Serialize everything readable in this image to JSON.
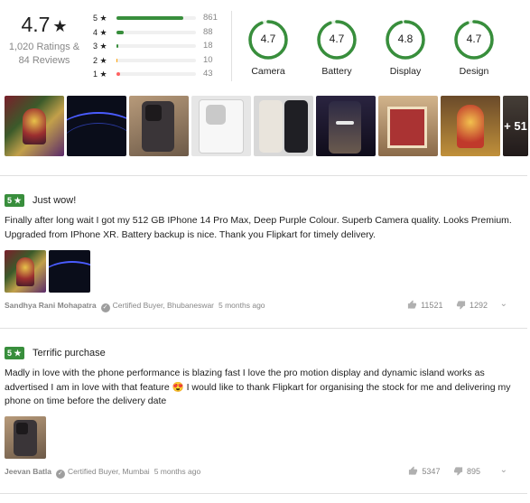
{
  "summary": {
    "overall_rating": "4.7",
    "star_glyph": "★",
    "ratings_text": "1,020 Ratings &",
    "reviews_text": "84 Reviews",
    "breakdown": [
      {
        "label": "5 ★",
        "count": "861",
        "fraction": 0.844,
        "color": "#388e3c"
      },
      {
        "label": "4 ★",
        "count": "88",
        "fraction": 0.086,
        "color": "#388e3c"
      },
      {
        "label": "3 ★",
        "count": "18",
        "fraction": 0.018,
        "color": "#388e3c"
      },
      {
        "label": "2 ★",
        "count": "10",
        "fraction": 0.01,
        "color": "#ff9f00"
      },
      {
        "label": "1 ★",
        "count": "43",
        "fraction": 0.042,
        "color": "#ff6161"
      }
    ],
    "aspects": [
      {
        "name": "Camera",
        "value": "4.7",
        "fraction": 0.94
      },
      {
        "name": "Battery",
        "value": "4.7",
        "fraction": 0.94
      },
      {
        "name": "Display",
        "value": "4.8",
        "fraction": 0.96
      },
      {
        "name": "Design",
        "value": "4.7",
        "fraction": 0.94
      }
    ]
  },
  "photo_strip": {
    "more_label": "+ 51",
    "photos": [
      "deity-idol-photo",
      "phone-wallpaper-dark-photo",
      "phone-camera-back-photo",
      "phone-in-box-photo",
      "phone-front-back-photo",
      "phone-screen-hand-photo",
      "temple-shrine-photo",
      "temple-idol-photo",
      "temple-crowd-photo"
    ]
  },
  "reviews": [
    {
      "rating": "5 ★",
      "title": "Just wow!",
      "body": "Finally after long wait I got my 512 GB IPhone 14 Pro Max, Deep Purple Colour. Superb Camera quality. Looks Premium. Upgraded from IPhone XR. Battery backup is nice. Thank you Flipkart for timely delivery.",
      "author": "Sandhya Rani Mohapatra",
      "certified": "Certified Buyer, Bhubaneswar",
      "ago": "5 months ago",
      "likes": "11521",
      "dislikes": "1292"
    },
    {
      "rating": "5 ★",
      "title": "Terrific purchase",
      "body": "Madly in love with the phone performance is blazing fast I love the pro motion display and dynamic island works as advertised I am in love with that feature 😍 I would like to thank Flipkart for organising the stock for me and delivering my phone on time before the delivery date",
      "author": "Jeevan Batla",
      "certified": "Certified Buyer, Mumbai",
      "ago": "5 months ago",
      "likes": "5347",
      "dislikes": "895"
    }
  ],
  "colors": {
    "green": "#388e3c",
    "orange": "#ff9f00",
    "red": "#ff6161",
    "muted": "#878787",
    "divider": "#e0e0e0"
  }
}
